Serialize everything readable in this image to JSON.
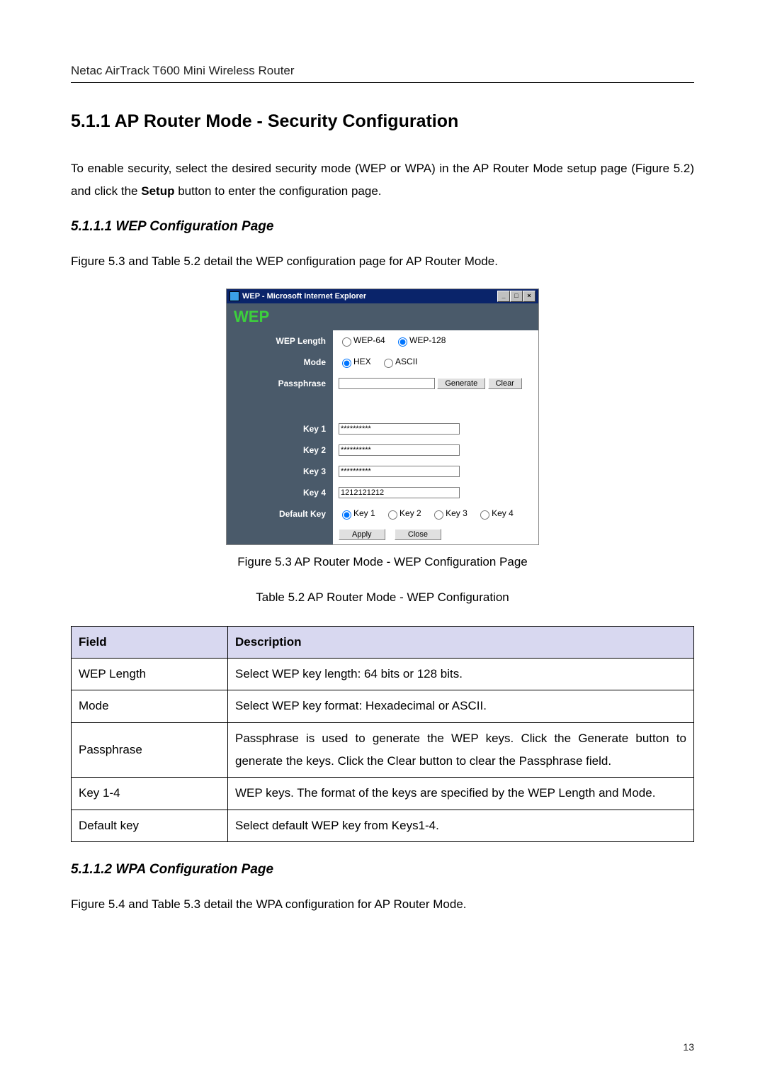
{
  "header": "Netac AirTrack T600 Mini Wireless Router",
  "section_title": "5.1.1 AP Router Mode - Security Configuration",
  "intro_text_pre": "To enable security, select the desired security mode (WEP or WPA) in the AP Router Mode setup page (Figure 5.2) and click the ",
  "intro_bold": "Setup",
  "intro_text_post": " button to enter the configuration page.",
  "sub1_title": "5.1.1.1 WEP Configuration Page",
  "sub1_text": "Figure 5.3 and Table 5.2 detail the WEP configuration page for AP Router Mode.",
  "figure_caption": "Figure 5.3 AP Router Mode - WEP Configuration Page",
  "table_caption": "Table 5.2 AP Router Mode - WEP Configuration",
  "ie_title": "WEP - Microsoft Internet Explorer",
  "wep": {
    "title": "WEP",
    "labels": {
      "wep_length": "WEP Length",
      "mode": "Mode",
      "passphrase": "Passphrase",
      "key1": "Key 1",
      "key2": "Key 2",
      "key3": "Key 3",
      "key4": "Key 4",
      "default_key": "Default Key"
    },
    "length_opt1": "WEP-64",
    "length_opt2": "WEP-128",
    "mode_opt1": "HEX",
    "mode_opt2": "ASCII",
    "btn_generate": "Generate",
    "btn_clear": "Clear",
    "btn_apply": "Apply",
    "btn_close": "Close",
    "key_masked": "**********",
    "key4_value": "1212121212",
    "dk1": "Key 1",
    "dk2": "Key 2",
    "dk3": "Key 3",
    "dk4": "Key 4"
  },
  "desc_table": {
    "h_field": "Field",
    "h_desc": "Description",
    "rows": [
      {
        "field": "WEP Length",
        "desc": "Select WEP key length: 64 bits or 128 bits."
      },
      {
        "field": "Mode",
        "desc": "Select WEP key format: Hexadecimal or ASCII."
      },
      {
        "field": "Passphrase",
        "desc_pre": "Passphrase is used to generate the WEP keys. Click the ",
        "b1": "Generate",
        "desc_mid": " button to generate the keys. Click the ",
        "b2": "Clear",
        "desc_post": " button to clear the Passphrase field."
      },
      {
        "field": "Key 1-4",
        "desc": "WEP keys. The format of the keys are specified by the WEP Length and Mode."
      },
      {
        "field": "Default key",
        "desc": "Select default WEP key from Keys1-4."
      }
    ]
  },
  "sub2_title": "5.1.1.2 WPA Configuration Page",
  "sub2_text": "Figure 5.4 and Table 5.3 detail the WPA configuration for AP Router Mode.",
  "page_number": "13"
}
